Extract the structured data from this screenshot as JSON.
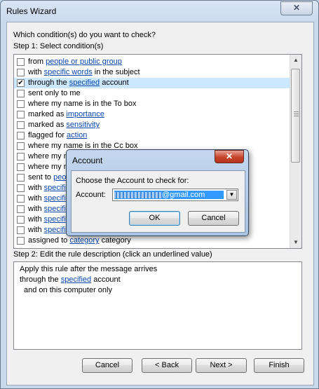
{
  "window": {
    "title": "Rules Wizard",
    "close_glyph": "✕"
  },
  "step1": {
    "question": "Which condition(s) do you want to check?",
    "label": "Step 1: Select condition(s)",
    "conditions": [
      {
        "pre": "from ",
        "link": "people or public group",
        "post": "",
        "checked": false
      },
      {
        "pre": "with ",
        "link": "specific words",
        "post": " in the subject",
        "checked": false
      },
      {
        "pre": "through the ",
        "link": "specified",
        "post": " account",
        "checked": true
      },
      {
        "pre": "sent only to me",
        "link": "",
        "post": "",
        "checked": false
      },
      {
        "pre": "where my name is in the To box",
        "link": "",
        "post": "",
        "checked": false
      },
      {
        "pre": "marked as ",
        "link": "importance",
        "post": "",
        "checked": false
      },
      {
        "pre": "marked as ",
        "link": "sensitivity",
        "post": "",
        "checked": false
      },
      {
        "pre": "flagged for ",
        "link": "action",
        "post": "",
        "checked": false
      },
      {
        "pre": "where my name is in the Cc box",
        "link": "",
        "post": "",
        "checked": false
      },
      {
        "pre": "where my n",
        "link": "",
        "post": "",
        "checked": false
      },
      {
        "pre": "where my n",
        "link": "",
        "post": "",
        "checked": false
      },
      {
        "pre": "sent to ",
        "link": "peo",
        "post": "",
        "checked": false
      },
      {
        "pre": "with ",
        "link": "specifi",
        "post": "",
        "checked": false
      },
      {
        "pre": "with ",
        "link": "specifi",
        "post": "",
        "checked": false
      },
      {
        "pre": "with ",
        "link": "specifi",
        "post": "",
        "checked": false
      },
      {
        "pre": "with ",
        "link": "specifi",
        "post": "",
        "checked": false
      },
      {
        "pre": "with ",
        "link": "specifi",
        "post": "",
        "checked": false
      },
      {
        "pre": "assigned to ",
        "link": "category",
        "post": " category",
        "checked": false
      }
    ],
    "scroll_up": "▲",
    "scroll_down": "▼"
  },
  "step2": {
    "label": "Step 2: Edit the rule description (click an underlined value)",
    "line1": "Apply this rule after the message arrives",
    "line2_pre": "through the ",
    "line2_link": "specified",
    "line2_post": " account",
    "line3": "and on this computer only"
  },
  "buttons": {
    "cancel": "Cancel",
    "back": "< Back",
    "next": "Next >",
    "finish": "Finish"
  },
  "dialog": {
    "title": "Account",
    "close_glyph": "✕",
    "prompt": "Choose the Account to check for:",
    "account_label": "Account:",
    "account_value_suffix": "@gmail.com",
    "dropdown_glyph": "▼",
    "ok": "OK",
    "cancel": "Cancel"
  }
}
